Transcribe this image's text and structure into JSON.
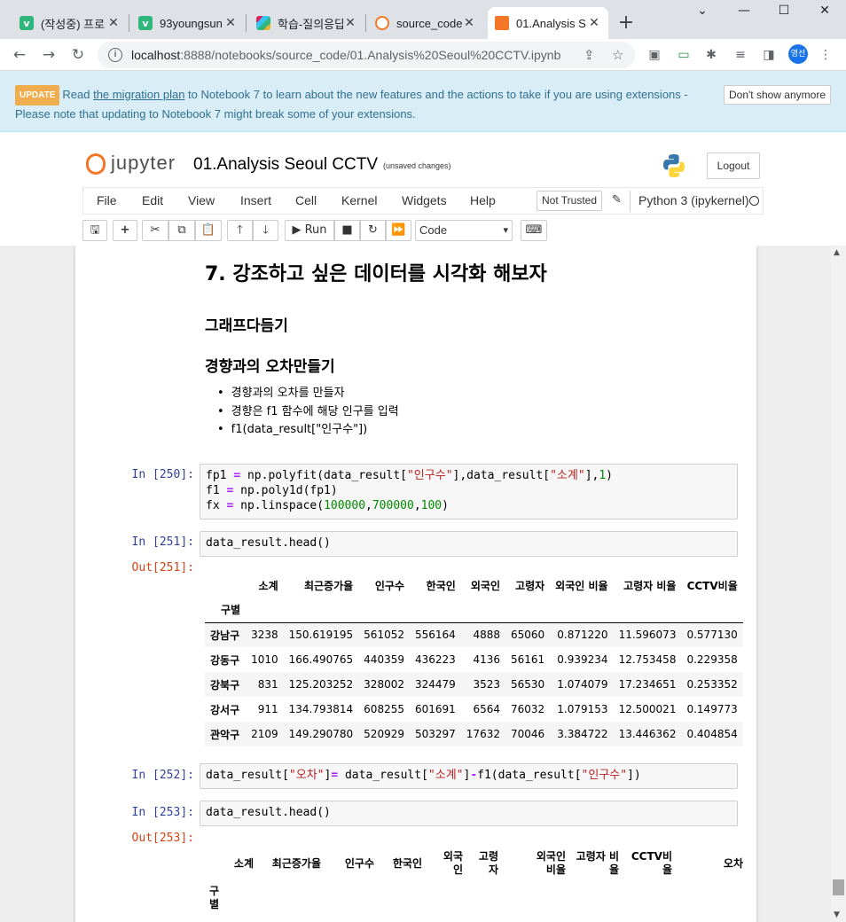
{
  "browser": {
    "tabs": [
      {
        "title": "(작성중) 프로",
        "favicon": "v",
        "color": "#2eb67d"
      },
      {
        "title": "93youngsun",
        "favicon": "v",
        "color": "#2eb67d"
      },
      {
        "title": "학습-질의응답",
        "favicon": "slack",
        "color": "#e01e5a"
      },
      {
        "title": "source_code/",
        "favicon": "jupyter",
        "color": "#f37726"
      },
      {
        "title": "01.Analysis S",
        "favicon": "book",
        "color": "#f37726"
      }
    ],
    "url_host": "localhost",
    "url_path": ":8888/notebooks/source_code/01.Analysis%20Seoul%20CCTV.ipynb",
    "profile_initials": "영선"
  },
  "banner": {
    "badge": "UPDATE",
    "pre": "Read ",
    "link": "the migration plan",
    "post": " to Notebook 7 to learn about the new features and the actions to take if you are using extensions - Please note that updating to Notebook 7 might break some of your extensions.",
    "dismiss": "Don't show anymore"
  },
  "header": {
    "logo_text": "jupyter",
    "notebook_title": "01.Analysis Seoul CCTV",
    "unsaved": "(unsaved changes)",
    "logout": "Logout"
  },
  "menu": {
    "items": [
      "File",
      "Edit",
      "View",
      "Insert",
      "Cell",
      "Kernel",
      "Widgets",
      "Help"
    ],
    "not_trusted": "Not Trusted",
    "kernel": "Python 3 (ipykernel)"
  },
  "toolbar": {
    "run": "Run",
    "cell_type": "Code"
  },
  "notebook": {
    "h1": "7. 강조하고 싶은 데이터를 시각화 해보자",
    "h2a": "그래프다듬기",
    "h2b": "경향과의 오차만들기",
    "bullets": [
      "경향과의 오차를 만들자",
      "경향은 f1 함수에 해당 인구를 입력",
      "f1(data_result[\"인구수\"])"
    ],
    "prompts": {
      "in250": "In [250]:",
      "in251": "In [251]:",
      "out251": "Out[251]:",
      "in252": "In [252]:",
      "in253": "In [253]:",
      "out253": "Out[253]:"
    },
    "cell253_code": "data_result.head()",
    "df1": {
      "columns": [
        "소계",
        "최근증가율",
        "인구수",
        "한국인",
        "외국인",
        "고령자",
        "외국인 비율",
        "고령자 비율",
        "CCTV비율"
      ],
      "index_name": "구별",
      "rows": [
        [
          "강남구",
          "3238",
          "150.619195",
          "561052",
          "556164",
          "4888",
          "65060",
          "0.871220",
          "11.596073",
          "0.577130"
        ],
        [
          "강동구",
          "1010",
          "166.490765",
          "440359",
          "436223",
          "4136",
          "56161",
          "0.939234",
          "12.753458",
          "0.229358"
        ],
        [
          "강북구",
          "831",
          "125.203252",
          "328002",
          "324479",
          "3523",
          "56530",
          "1.074079",
          "17.234651",
          "0.253352"
        ],
        [
          "강서구",
          "911",
          "134.793814",
          "608255",
          "601691",
          "6564",
          "76032",
          "1.079153",
          "12.500021",
          "0.149773"
        ],
        [
          "관악구",
          "2109",
          "149.290780",
          "520929",
          "503297",
          "17632",
          "70046",
          "3.384722",
          "13.446362",
          "0.404854"
        ]
      ]
    },
    "df2": {
      "columns": [
        "소계",
        "최근증가율",
        "인구수",
        "한국인",
        "외국\n인",
        "고령\n자",
        "외국인\n비율",
        "고령자 비\n율",
        "CCTV비\n율",
        "오차"
      ],
      "index_name": "구\n별"
    }
  }
}
